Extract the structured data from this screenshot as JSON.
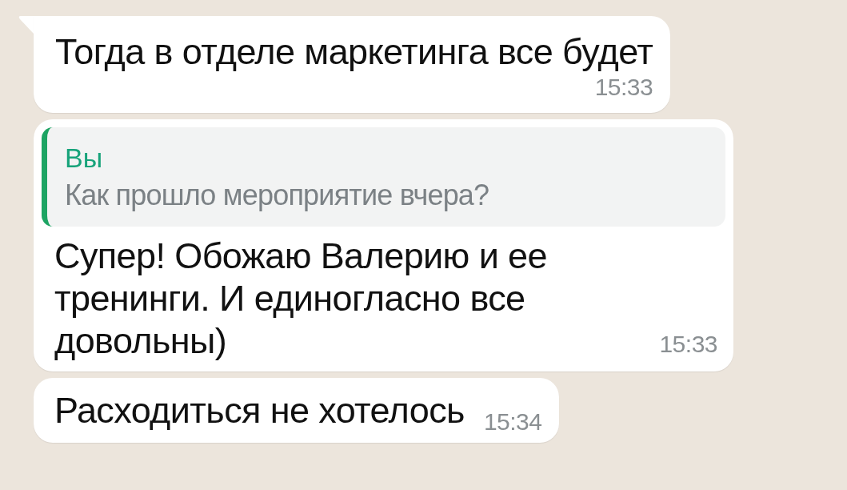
{
  "messages": [
    {
      "kind": "text",
      "tail": true,
      "text": "Тогда в отделе маркетинга все будет",
      "time": "15:33"
    },
    {
      "kind": "reply",
      "tail": false,
      "quote": {
        "author": "Вы",
        "text": "Как прошло мероприятие вчера?"
      },
      "text": "Супер! Обожаю Валерию и ее тренинги. И единогласно все довольны)",
      "time": "15:33"
    },
    {
      "kind": "inline",
      "tail": false,
      "text": "Расходиться не хотелось",
      "time": "15:34"
    }
  ]
}
